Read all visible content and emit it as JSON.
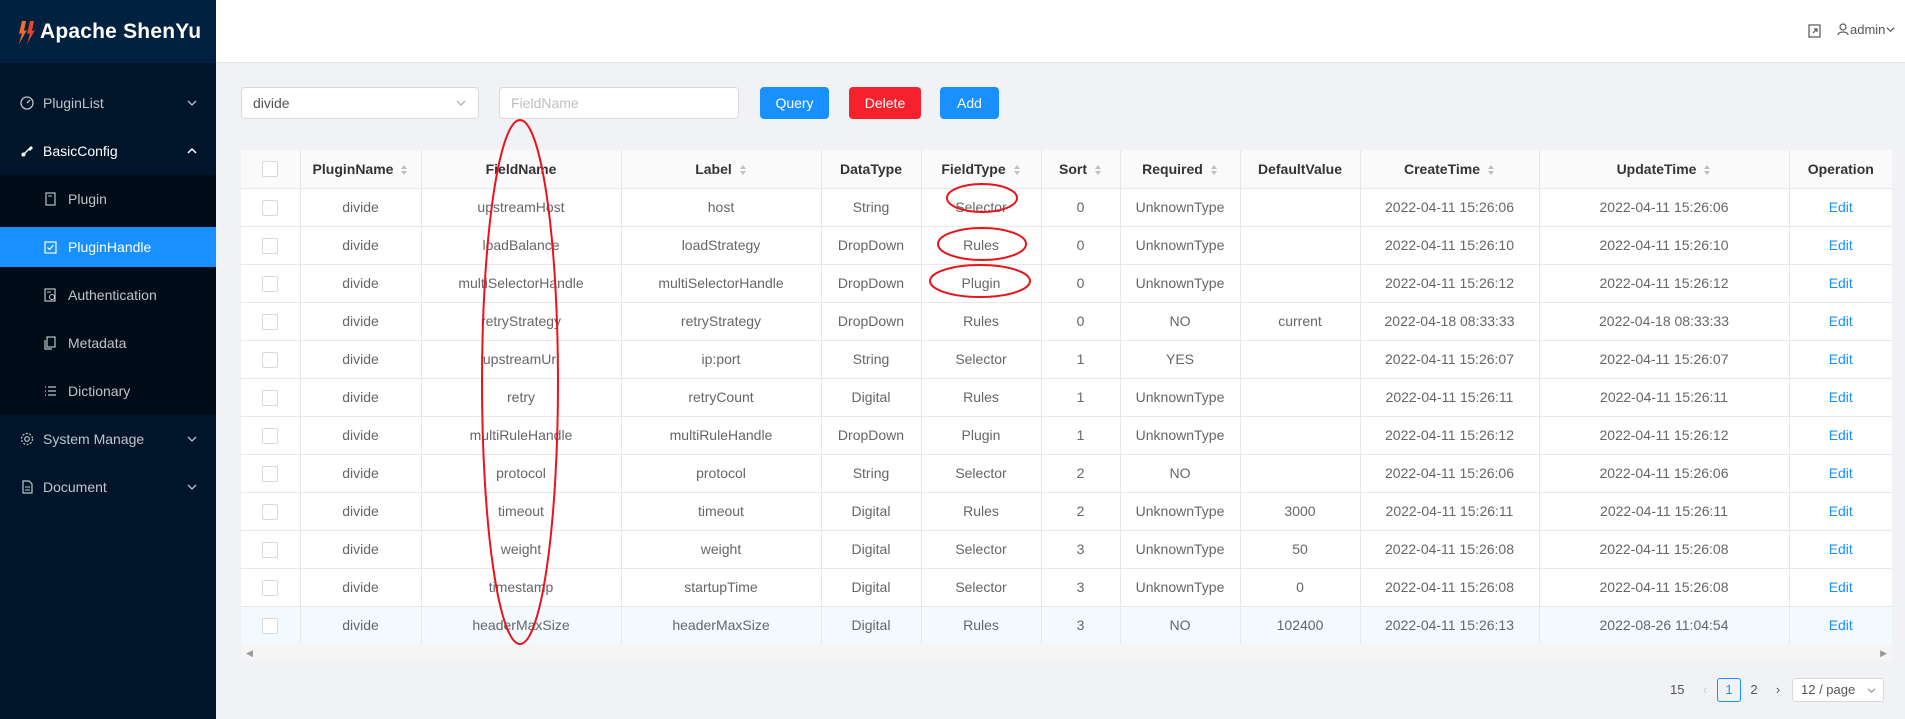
{
  "app": {
    "title": "Apache ShenYu",
    "user": "admin"
  },
  "sidebar": {
    "items": [
      {
        "label": "PluginList",
        "icon": "dashboard-icon"
      },
      {
        "label": "BasicConfig",
        "icon": "setting-icon"
      },
      {
        "label": "Plugin",
        "icon": "file-icon"
      },
      {
        "label": "PluginHandle",
        "icon": "form-icon"
      },
      {
        "label": "Authentication",
        "icon": "audit-icon"
      },
      {
        "label": "Metadata",
        "icon": "snippets-icon"
      },
      {
        "label": "Dictionary",
        "icon": "unordered-list-icon"
      },
      {
        "label": "System Manage",
        "icon": "setting-icon"
      },
      {
        "label": "Document",
        "icon": "file-text-icon"
      }
    ]
  },
  "toolbar": {
    "plugin_select": "divide",
    "field_placeholder": "FieldName",
    "query_label": "Query",
    "delete_label": "Delete",
    "add_label": "Add"
  },
  "table": {
    "columns": [
      "",
      "PluginName",
      "FieldName",
      "Label",
      "DataType",
      "FieldType",
      "Sort",
      "Required",
      "DefaultValue",
      "CreateTime",
      "UpdateTime",
      "Operation"
    ],
    "rows": [
      [
        "divide",
        "upstreamHost",
        "host",
        "String",
        "Selector",
        "0",
        "UnknownType",
        "",
        "2022-04-11 15:26:06",
        "2022-04-11 15:26:06",
        "Edit"
      ],
      [
        "divide",
        "loadBalance",
        "loadStrategy",
        "DropDown",
        "Rules",
        "0",
        "UnknownType",
        "",
        "2022-04-11 15:26:10",
        "2022-04-11 15:26:10",
        "Edit"
      ],
      [
        "divide",
        "multiSelectorHandle",
        "multiSelectorHandle",
        "DropDown",
        "Plugin",
        "0",
        "UnknownType",
        "",
        "2022-04-11 15:26:12",
        "2022-04-11 15:26:12",
        "Edit"
      ],
      [
        "divide",
        "retryStrategy",
        "retryStrategy",
        "DropDown",
        "Rules",
        "0",
        "NO",
        "current",
        "2022-04-18 08:33:33",
        "2022-04-18 08:33:33",
        "Edit"
      ],
      [
        "divide",
        "upstreamUrl",
        "ip:port",
        "String",
        "Selector",
        "1",
        "YES",
        "",
        "2022-04-11 15:26:07",
        "2022-04-11 15:26:07",
        "Edit"
      ],
      [
        "divide",
        "retry",
        "retryCount",
        "Digital",
        "Rules",
        "1",
        "UnknownType",
        "",
        "2022-04-11 15:26:11",
        "2022-04-11 15:26:11",
        "Edit"
      ],
      [
        "divide",
        "multiRuleHandle",
        "multiRuleHandle",
        "DropDown",
        "Plugin",
        "1",
        "UnknownType",
        "",
        "2022-04-11 15:26:12",
        "2022-04-11 15:26:12",
        "Edit"
      ],
      [
        "divide",
        "protocol",
        "protocol",
        "String",
        "Selector",
        "2",
        "NO",
        "",
        "2022-04-11 15:26:06",
        "2022-04-11 15:26:06",
        "Edit"
      ],
      [
        "divide",
        "timeout",
        "timeout",
        "Digital",
        "Rules",
        "2",
        "UnknownType",
        "3000",
        "2022-04-11 15:26:11",
        "2022-04-11 15:26:11",
        "Edit"
      ],
      [
        "divide",
        "weight",
        "weight",
        "Digital",
        "Selector",
        "3",
        "UnknownType",
        "50",
        "2022-04-11 15:26:08",
        "2022-04-11 15:26:08",
        "Edit"
      ],
      [
        "divide",
        "timestamp",
        "startupTime",
        "Digital",
        "Selector",
        "3",
        "UnknownType",
        "0",
        "2022-04-11 15:26:08",
        "2022-04-11 15:26:08",
        "Edit"
      ],
      [
        "divide",
        "headerMaxSize",
        "headerMaxSize",
        "Digital",
        "Rules",
        "3",
        "NO",
        "102400",
        "2022-04-11 15:26:13",
        "2022-08-26 11:04:54",
        "Edit"
      ]
    ]
  },
  "pagination": {
    "total": "15",
    "pages": [
      "1",
      "2"
    ],
    "page_size": "12 / page"
  },
  "colors": {
    "primary": "#1890ff",
    "danger": "#f5222d",
    "sidebar": "#001529",
    "annotation": "#e8141c"
  }
}
